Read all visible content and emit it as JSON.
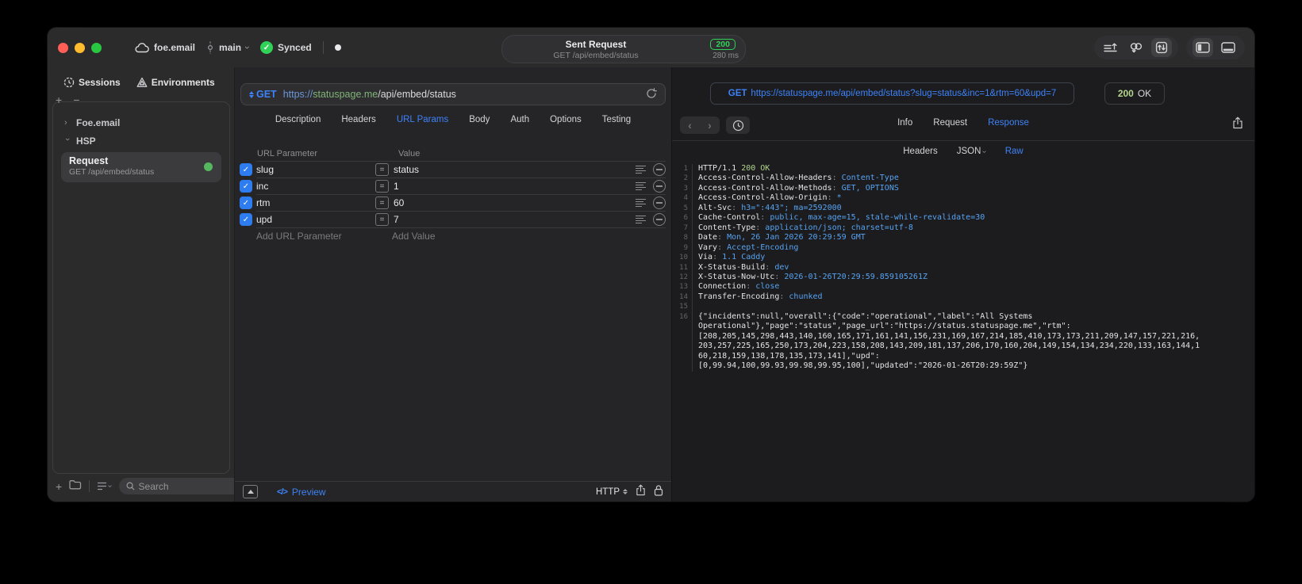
{
  "colors": {
    "accent_blue": "#3e82f7",
    "status_green": "#30d158",
    "request_dot_green": "#55b85e",
    "checkbox_blue": "#2d7cf0",
    "code_value_blue": "#56a3f2",
    "code_status_green": "#b3d48e",
    "traffic_red": "#ff5f57",
    "traffic_yellow": "#febc2e",
    "traffic_green": "#28c840"
  },
  "icons": {
    "check": "✓",
    "plus": "+",
    "minus": "−",
    "back": "‹",
    "forward": "›",
    "chevron": "›",
    "equals": "=",
    "code": "</>"
  },
  "titlebar": {
    "project": "foe.email",
    "branch": "main",
    "sync_label": "Synced",
    "center": {
      "title": "Sent Request",
      "subtitle": "GET /api/embed/status",
      "status": "200",
      "time": "280 ms"
    }
  },
  "sidebar": {
    "tabs": [
      {
        "label": "Sessions"
      },
      {
        "label": "Environments"
      }
    ],
    "groups": [
      {
        "label": "Foe.email",
        "expanded": false
      },
      {
        "label": "HSP",
        "expanded": true
      }
    ],
    "request": {
      "title": "Request",
      "subtitle": "GET /api/embed/status"
    },
    "search_placeholder": "Search"
  },
  "request_editor": {
    "method": "GET",
    "url": {
      "scheme": "https://",
      "host": "statuspage.me",
      "path": "/api/embed/status"
    },
    "tabs": [
      "Description",
      "Headers",
      "URL Params",
      "Body",
      "Auth",
      "Options",
      "Testing"
    ],
    "active_tab": "URL Params",
    "params": {
      "name_header": "URL Parameter",
      "value_header": "Value",
      "rows": [
        {
          "name": "slug",
          "value": "status",
          "checked": true
        },
        {
          "name": "inc",
          "value": "1",
          "checked": true
        },
        {
          "name": "rtm",
          "value": "60",
          "checked": true
        },
        {
          "name": "upd",
          "value": "7",
          "checked": true
        }
      ],
      "add_name": "Add URL Parameter",
      "add_value": "Add Value"
    },
    "footer": {
      "preview": "Preview",
      "protocol": "HTTP"
    }
  },
  "response_viewer": {
    "request_line": {
      "method": "GET",
      "url": "https://statuspage.me/api/embed/status?slug=status&inc=1&rtm=60&upd=7"
    },
    "status": {
      "code": "200",
      "text": "OK"
    },
    "tabs": [
      "Info",
      "Request",
      "Response"
    ],
    "active_tab": "Response",
    "subtabs": [
      {
        "label": "Headers"
      },
      {
        "label": "JSON",
        "chevron": true
      },
      {
        "label": "Raw",
        "active": true
      }
    ],
    "status_line": {
      "protocol": "HTTP/1.1",
      "status": "200 OK"
    },
    "headers": [
      [
        "Access-Control-Allow-Headers",
        "Content-Type"
      ],
      [
        "Access-Control-Allow-Methods",
        "GET, OPTIONS"
      ],
      [
        "Access-Control-Allow-Origin",
        "*"
      ],
      [
        "Alt-Svc",
        "h3=\":443\"; ma=2592000"
      ],
      [
        "Cache-Control",
        "public, max-age=15, stale-while-revalidate=30"
      ],
      [
        "Content-Type",
        "application/json; charset=utf-8"
      ],
      [
        "Date",
        "Mon, 26 Jan 2026 20:29:59 GMT"
      ],
      [
        "Vary",
        "Accept-Encoding"
      ],
      [
        "Via",
        "1.1 Caddy"
      ],
      [
        "X-Status-Build",
        "dev"
      ],
      [
        "X-Status-Now-Utc",
        "2026-01-26T20:29:59.859105261Z"
      ],
      [
        "Connection",
        "close"
      ],
      [
        "Transfer-Encoding",
        "chunked"
      ]
    ],
    "blank_line_number": "15",
    "body_line_number": "16",
    "body_lines": [
      "{\"incidents\":null,\"overall\":{\"code\":\"operational\",\"label\":\"All Systems",
      "Operational\"},\"page\":\"status\",\"page_url\":\"https://status.statuspage.me\",\"rtm\":",
      "[208,205,145,298,443,140,160,165,171,161,141,156,231,169,167,214,185,410,173,173,211,209,147,157,221,216,",
      "203,257,225,165,250,173,204,223,158,208,143,209,181,137,206,170,160,204,149,154,134,234,220,133,163,144,1",
      "60,218,159,138,178,135,173,141],\"upd\":",
      "[0,99.94,100,99.93,99.98,99.95,100],\"updated\":\"2026-01-26T20:29:59Z\"}"
    ]
  }
}
